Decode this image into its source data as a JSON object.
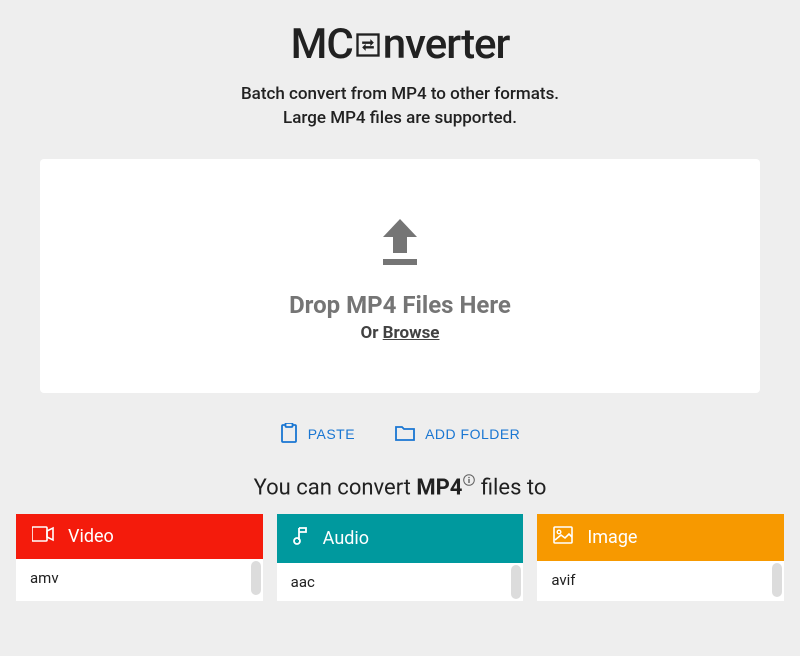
{
  "logo": {
    "prefix": "MC",
    "suffix": "nverter"
  },
  "subtitle": {
    "line1": "Batch convert from MP4 to other formats.",
    "line2": "Large MP4 files are supported."
  },
  "dropzone": {
    "main_text": "Drop MP4 Files Here",
    "or_text": "Or ",
    "browse_text": "Browse"
  },
  "actions": {
    "paste": "PASTE",
    "add_folder": "ADD FOLDER"
  },
  "convert_heading": {
    "prefix": "You can convert ",
    "format": "MP4",
    "suffix": " files to"
  },
  "cards": {
    "video": {
      "title": "Video",
      "first_item": "amv"
    },
    "audio": {
      "title": "Audio",
      "first_item": "aac"
    },
    "image": {
      "title": "Image",
      "first_item": "avif"
    }
  }
}
